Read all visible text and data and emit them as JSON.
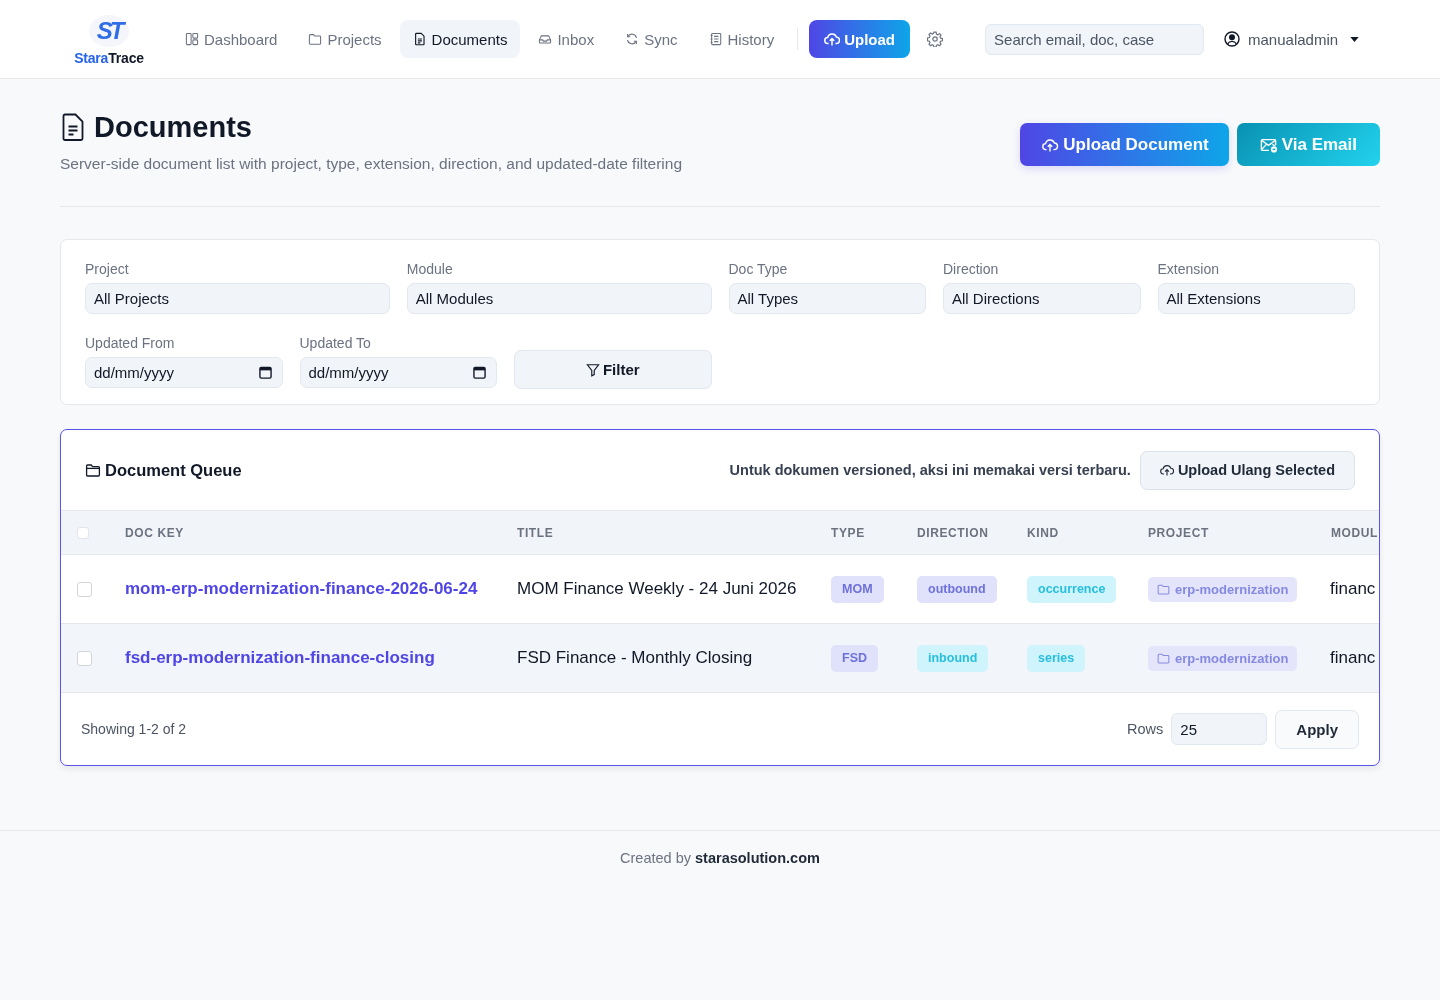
{
  "navbar": {
    "brand": {
      "logo_mark": "ST",
      "name_lead": "Stara",
      "name_tail": "Trace"
    },
    "nav_items": [
      {
        "label": "Dashboard",
        "selected": false
      },
      {
        "label": "Projects",
        "selected": false
      },
      {
        "label": "Documents",
        "selected": true
      },
      {
        "label": "Inbox",
        "selected": false
      },
      {
        "label": "Sync",
        "selected": false
      },
      {
        "label": "History",
        "selected": false
      }
    ],
    "upload_button": "Upload",
    "search": {
      "placeholder": "Search email, doc, case"
    },
    "user": {
      "name": "manualadmin"
    }
  },
  "page_header": {
    "title": "Documents",
    "subtitle": "Server-side document list with project, type, extension, direction, and updated-date filtering",
    "actions": [
      {
        "label": "Upload Document",
        "kind": "primary"
      },
      {
        "label": "Via Email",
        "kind": "info"
      }
    ]
  },
  "filters": {
    "selects": [
      {
        "label": "Project",
        "value": "All Projects"
      },
      {
        "label": "Module",
        "value": "All Modules"
      },
      {
        "label": "Doc Type",
        "value": "All Types"
      },
      {
        "label": "Direction",
        "value": "All Directions"
      },
      {
        "label": "Extension",
        "value": "All Extensions"
      }
    ],
    "date_fields": [
      {
        "label": "Updated From",
        "placeholder": "dd/mm/yyyy"
      },
      {
        "label": "Updated To",
        "placeholder": "dd/mm/yyyy"
      }
    ],
    "filter_button": "Filter"
  },
  "queue": {
    "title": "Document Queue",
    "note": "Untuk dokumen versioned, aksi ini memakai versi terbaru.",
    "action_button": "Upload Ulang Selected",
    "select_all": {
      "checked": false
    },
    "columns": [
      "DOC KEY",
      "TITLE",
      "TYPE",
      "DIRECTION",
      "KIND",
      "PROJECT",
      "MODUL"
    ],
    "rows": [
      {
        "checked": false,
        "doc_key": "mom-erp-modernization-finance-2026-06-24",
        "title": "MOM Finance Weekly - 24 Juni 2026",
        "type": {
          "label": "MOM",
          "color": "#e0e1fb"
        },
        "direction": {
          "label": "outbound",
          "color": "#e0e1fb"
        },
        "doc_kind": {
          "label": "occurrence",
          "color": "#cff4fc"
        },
        "project": "erp-modernization",
        "column_7": "financ"
      },
      {
        "checked": false,
        "doc_key": "fsd-erp-modernization-finance-closing",
        "title": "FSD Finance - Monthly Closing",
        "type": {
          "label": "FSD",
          "color": "#e0e1fb"
        },
        "direction": {
          "label": "inbound",
          "color": "#cff4fc"
        },
        "doc_kind": {
          "label": "series",
          "color": "#cff4fc"
        },
        "project": "erp-modernization",
        "column_7": "financ"
      }
    ],
    "footer": {
      "summary": "Showing 1-2 of 2",
      "rows_label": "Rows",
      "rows_value": "25",
      "apply_button": "Apply"
    }
  },
  "page_footer": {
    "credit": "Created by",
    "link": "starasolution.com"
  }
}
